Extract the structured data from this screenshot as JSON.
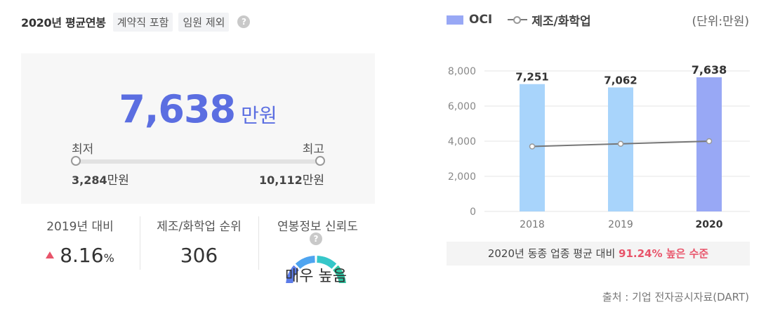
{
  "left": {
    "title": "2020년 평균연봉",
    "chip_contract": "계약직 포함",
    "chip_exec": "임원 제외",
    "help": "?",
    "avg_value": "7,638",
    "avg_unit": "만원",
    "min_label": "최저",
    "max_label": "최고",
    "min_value": "3,284",
    "max_value": "10,112",
    "value_unit": "만원",
    "stat_yoy_label": "2019년 대비",
    "stat_yoy_value": "8.16",
    "stat_yoy_pct": "%",
    "stat_rank_label": "제조/화학업 순위",
    "stat_rank_value": "306",
    "stat_trust_label": "연봉정보 신뢰도",
    "stat_trust_value": "매우 높음",
    "gauge_colors": [
      "#5b7be8",
      "#4ea4f0",
      "#36c7c9",
      "#2dc3a0"
    ]
  },
  "legend": {
    "bar_name": "OCI",
    "line_name": "제조/화학업",
    "unit": "(단위:만원)"
  },
  "chart_data": {
    "type": "bar",
    "categories": [
      "2018",
      "2019",
      "2020"
    ],
    "series": [
      {
        "name": "OCI",
        "type": "bar",
        "values": [
          7251,
          7062,
          7638
        ],
        "labels": [
          "7,251",
          "7,062",
          "7,638"
        ],
        "colors": [
          "#a8d4fb",
          "#a8d4fb",
          "#98a8f5"
        ]
      },
      {
        "name": "제조/화학업",
        "type": "line",
        "values": [
          3700,
          3850,
          4000
        ],
        "color": "#777777"
      }
    ],
    "ylim": [
      0,
      8000
    ],
    "yticks": [
      "0",
      "2,000",
      "4,000",
      "6,000",
      "8,000"
    ],
    "ytick_values": [
      0,
      2000,
      4000,
      6000,
      8000
    ],
    "highlight_category": "2020",
    "grid": true
  },
  "compare": {
    "prefix": "2020년 동종 업종 평균 대비 ",
    "highlight": "91.24% 높은 수준"
  },
  "source": "출처 : 기업 전자공시자료(DART)"
}
